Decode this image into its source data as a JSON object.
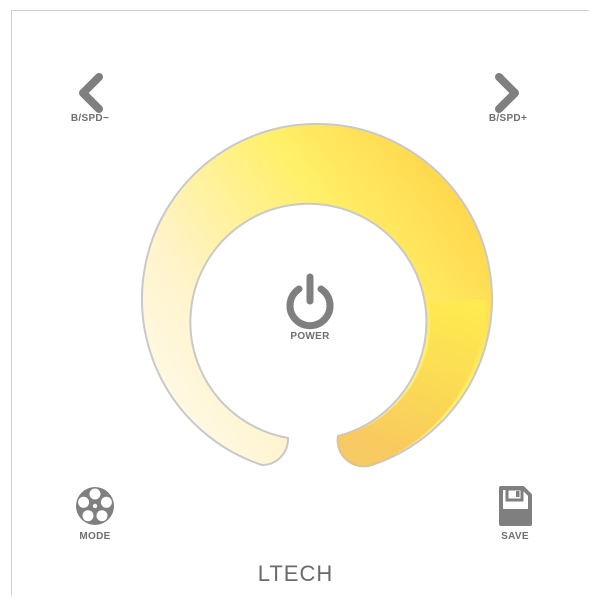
{
  "buttons": {
    "prev_label": "B/SPD−",
    "next_label": "B/SPD+",
    "power_label": "POWER",
    "mode_label": "MODE",
    "save_label": "SAVE"
  },
  "brand": {
    "name": "LTECH"
  },
  "icons": {
    "prev": "chevron-left-icon",
    "next": "chevron-right-icon",
    "power": "power-icon",
    "mode": "film-reel-icon",
    "save": "floppy-disk-icon"
  },
  "colors": {
    "icon_gray": "#7f7f7f",
    "ring_warm_white": "#fffaf0",
    "ring_yellow": "#ffef4a",
    "ring_amber": "#f7c34a",
    "ring_edge": "#c8c8c8"
  }
}
